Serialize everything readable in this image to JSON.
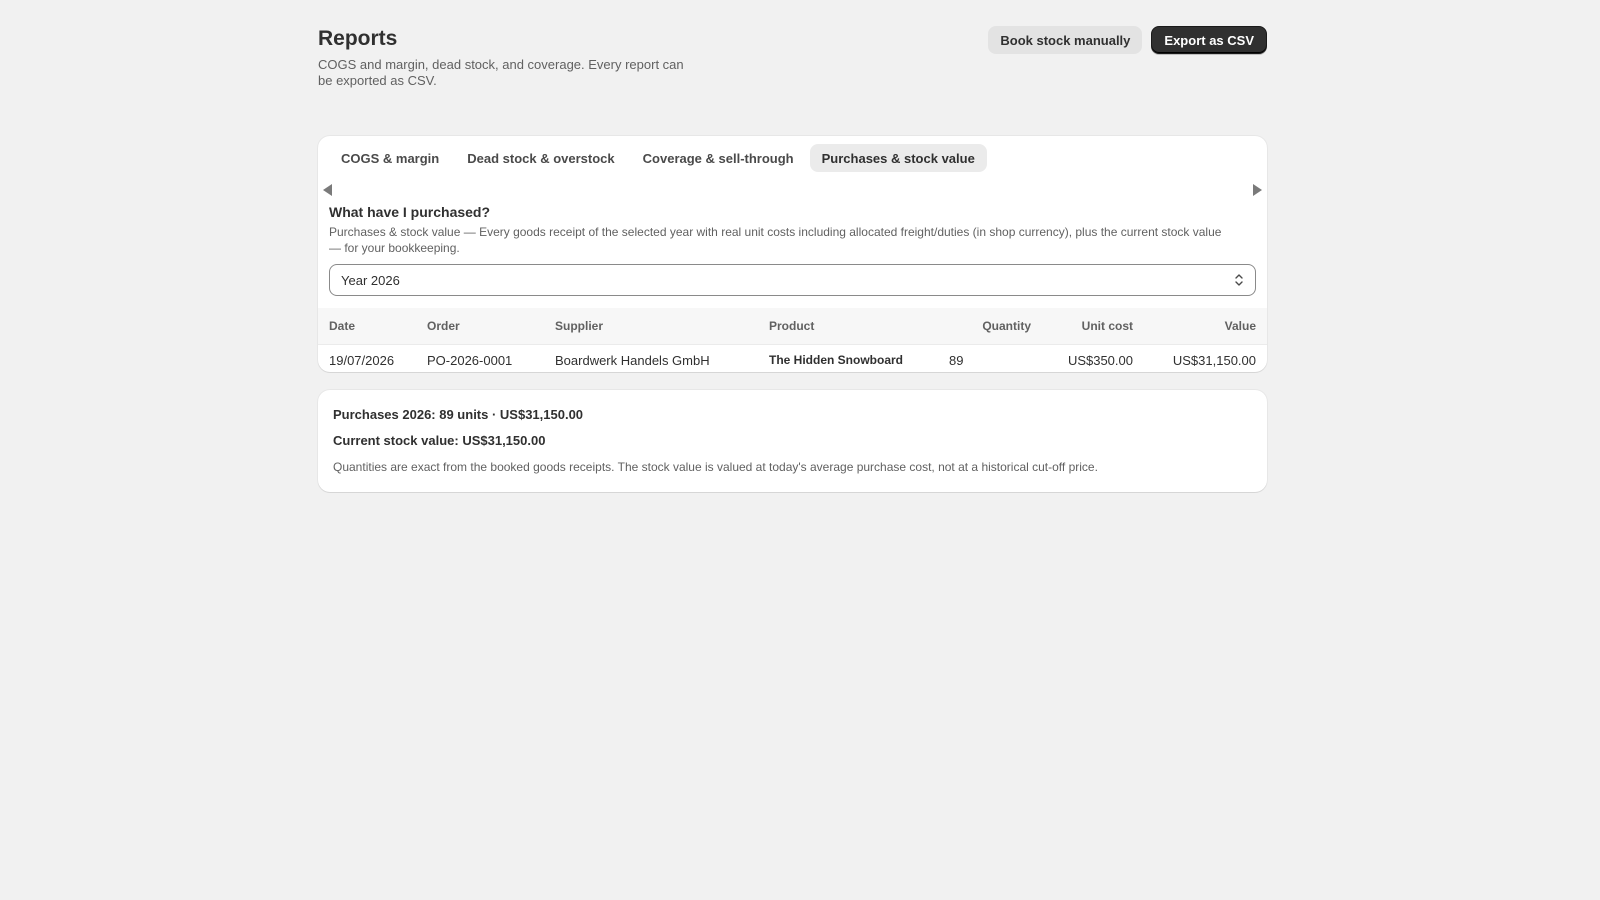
{
  "header": {
    "title": "Reports",
    "subtitle": "COGS and margin, dead stock, and coverage. Every report can be exported as CSV.",
    "book_stock_label": "Book stock manually",
    "export_label": "Export as CSV"
  },
  "tabs": [
    {
      "label": "COGS & margin",
      "active": false
    },
    {
      "label": "Dead stock & overstock",
      "active": false
    },
    {
      "label": "Coverage & sell-through",
      "active": false
    },
    {
      "label": "Purchases & stock value",
      "active": true
    }
  ],
  "section": {
    "heading": "What have I purchased?",
    "description": "Purchases & stock value — Every goods receipt of the selected year with real unit costs including allocated freight/duties (in shop currency), plus the current stock value — for your bookkeeping.",
    "year_select": {
      "value": "Year 2026"
    }
  },
  "table": {
    "columns": [
      "Date",
      "Order",
      "Supplier",
      "Product",
      "Quantity",
      "Unit cost",
      "Value"
    ],
    "rows": [
      {
        "date": "19/07/2026",
        "order": "PO-2026-0001",
        "supplier": "Boardwerk Handels GmbH",
        "product": "The Hidden Snowboard",
        "quantity": "89",
        "unit_cost": "US$350.00",
        "value": "US$31,150.00"
      }
    ]
  },
  "summary": {
    "purchases_line": "Purchases 2026: 89 units · US$31,150.00",
    "stock_value_line": "Current stock value: US$31,150.00",
    "note": "Quantities are exact from the booked goods receipts. The stock value is valued at today's average purchase cost, not at a historical cut-off price."
  }
}
